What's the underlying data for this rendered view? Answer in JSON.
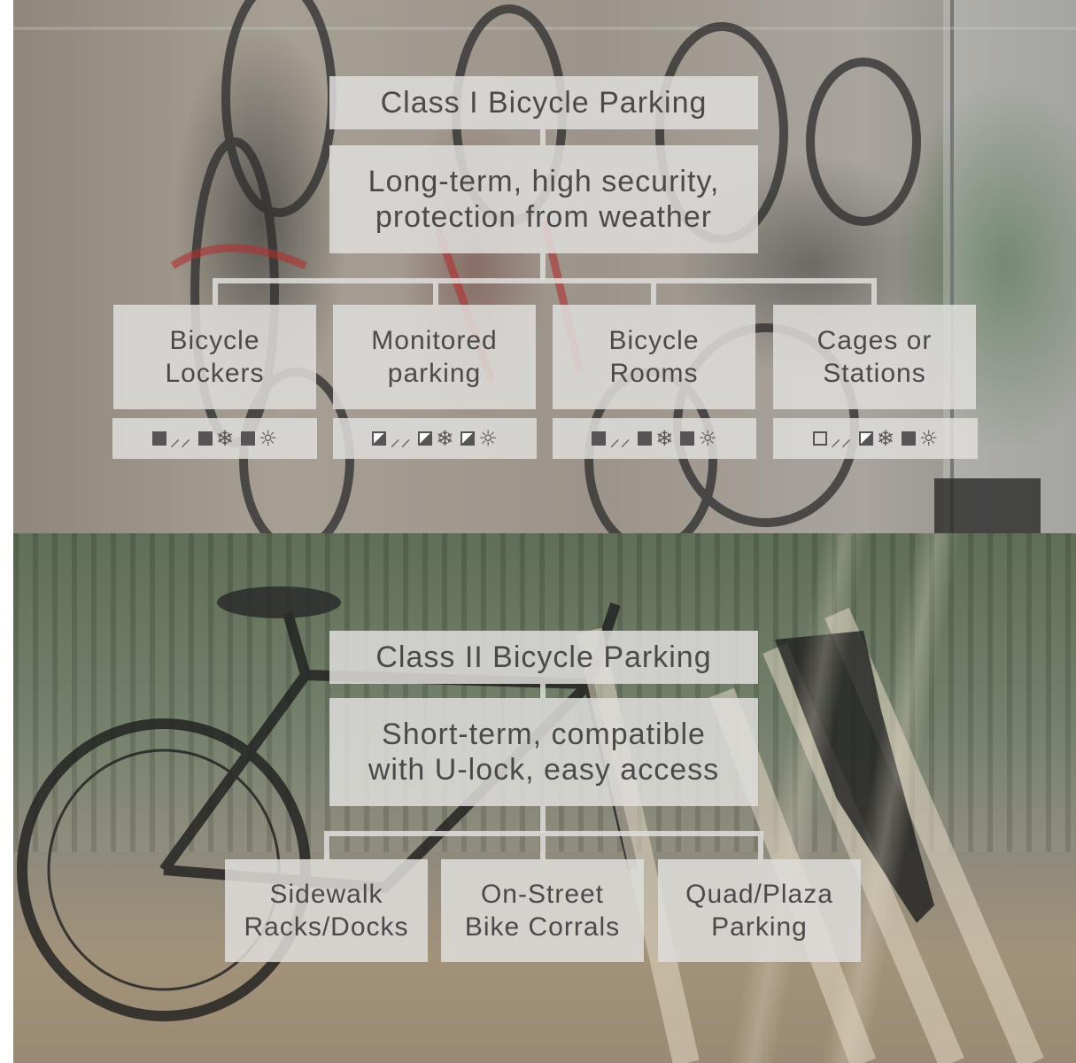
{
  "class1": {
    "title": "Class I Bicycle Parking",
    "description_line1": "Long-term, high security,",
    "description_line2": "protection from weather",
    "types": [
      {
        "line1": "Bicycle",
        "line2": "Lockers",
        "ratings": [
          {
            "level": "full",
            "icon": "rain-icon"
          },
          {
            "level": "full",
            "icon": "snow-icon"
          },
          {
            "level": "full",
            "icon": "sun-icon"
          }
        ]
      },
      {
        "line1": "Monitored",
        "line2": "parking",
        "ratings": [
          {
            "level": "half",
            "icon": "rain-icon"
          },
          {
            "level": "half",
            "icon": "snow-icon"
          },
          {
            "level": "half",
            "icon": "sun-icon"
          }
        ]
      },
      {
        "line1": "Bicycle",
        "line2": "Rooms",
        "ratings": [
          {
            "level": "full",
            "icon": "rain-icon"
          },
          {
            "level": "full",
            "icon": "snow-icon"
          },
          {
            "level": "full",
            "icon": "sun-icon"
          }
        ]
      },
      {
        "line1": "Cages or",
        "line2": "Stations",
        "ratings": [
          {
            "level": "empty",
            "icon": "rain-icon"
          },
          {
            "level": "half",
            "icon": "snow-icon"
          },
          {
            "level": "full",
            "icon": "sun-icon"
          }
        ]
      }
    ]
  },
  "class2": {
    "title": "Class II Bicycle Parking",
    "description_line1": "Short-term, compatible",
    "description_line2": "with U-lock, easy access",
    "types": [
      {
        "line1": "Sidewalk",
        "line2": "Racks/Docks"
      },
      {
        "line1": "On-Street",
        "line2": "Bike Corrals"
      },
      {
        "line1": "Quad/Plaza",
        "line2": "Parking"
      }
    ]
  },
  "icons": {
    "rain-icon": "⸝⸝",
    "snow-icon": "❄",
    "sun-icon": "☼"
  },
  "colors": {
    "box": "#dedddb",
    "text": "#4a4a4a",
    "rating": "#555555"
  }
}
